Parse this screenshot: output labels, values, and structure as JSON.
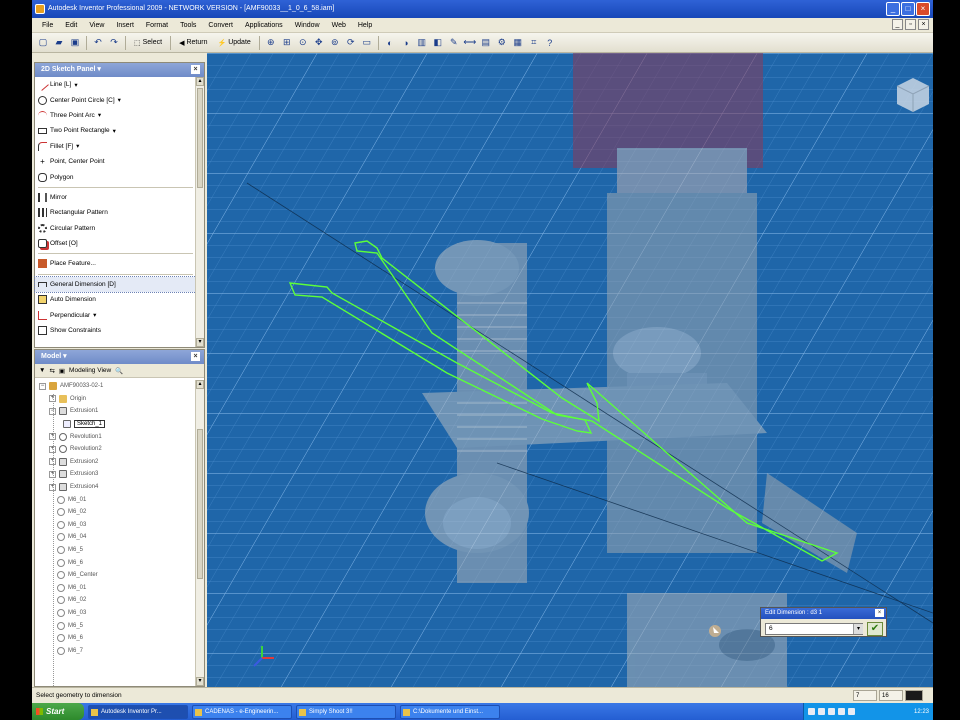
{
  "window": {
    "title": "Autodesk Inventor Professional 2009 - NETWORK VERSION - [AMF90033__1_0_6_58.iam]",
    "controls": [
      "_",
      "□",
      "×"
    ]
  },
  "menubar": {
    "items": [
      "File",
      "Edit",
      "View",
      "Insert",
      "Format",
      "Tools",
      "Convert",
      "Applications",
      "Window",
      "Web",
      "Help"
    ]
  },
  "toolbar": {
    "select_label": "Select",
    "return_label": "Return",
    "update_label": "Update"
  },
  "sketch_panel": {
    "title": "2D Sketch Panel",
    "items": [
      {
        "label": "Line  [L]",
        "icon": "line-icon"
      },
      {
        "label": "Center Point Circle  [C]",
        "icon": "circle-icon"
      },
      {
        "label": "Three Point Arc",
        "icon": "arc-icon"
      },
      {
        "label": "Two Point Rectangle",
        "icon": "rectangle-icon"
      },
      {
        "label": "Fillet  [F]",
        "icon": "fillet-icon"
      },
      {
        "label": "Point, Center Point",
        "icon": "point-icon"
      },
      {
        "label": "Polygon",
        "icon": "polygon-icon"
      },
      {
        "label": "Mirror",
        "icon": "mirror-icon"
      },
      {
        "label": "Rectangular Pattern",
        "icon": "rect-pattern-icon"
      },
      {
        "label": "Circular Pattern",
        "icon": "circ-pattern-icon"
      },
      {
        "label": "Offset  [O]",
        "icon": "offset-icon"
      },
      {
        "label": "Place Feature...",
        "icon": "place-feature-icon"
      },
      {
        "label": "General Dimension  [D]",
        "icon": "dimension-icon"
      },
      {
        "label": "Auto Dimension",
        "icon": "auto-dimension-icon"
      },
      {
        "label": "Perpendicular",
        "icon": "perpendicular-icon"
      },
      {
        "label": "Show Constraints",
        "icon": "constraints-icon"
      }
    ]
  },
  "model_panel": {
    "title": "Model",
    "view_label": "Modeling View",
    "tree": [
      {
        "label": "AMF90033-02-1",
        "level": 0
      },
      {
        "label": "Origin",
        "level": 1
      },
      {
        "label": "Extrusion1",
        "level": 1
      },
      {
        "label": "Sketch_1",
        "level": 2,
        "selected": true
      },
      {
        "label": "Revolution1",
        "level": 1
      },
      {
        "label": "Revolution2",
        "level": 1
      },
      {
        "label": "Extrusion2",
        "level": 1
      },
      {
        "label": "Extrusion3",
        "level": 1
      },
      {
        "label": "Extrusion4",
        "level": 1
      },
      {
        "label": "M6_01",
        "level": 1
      },
      {
        "label": "M6_02",
        "level": 1
      },
      {
        "label": "M6_03",
        "level": 1
      },
      {
        "label": "M6_04",
        "level": 1
      },
      {
        "label": "M6_5",
        "level": 1
      },
      {
        "label": "M6_6",
        "level": 1
      },
      {
        "label": "M6_Center",
        "level": 1
      },
      {
        "label": "M6_01",
        "level": 1
      },
      {
        "label": "M6_02",
        "level": 1
      },
      {
        "label": "M6_03",
        "level": 1
      },
      {
        "label": "M6_5",
        "level": 1
      },
      {
        "label": "M6_6",
        "level": 1
      },
      {
        "label": "M6_7",
        "level": 1
      }
    ]
  },
  "edit_dimension": {
    "title": "Edit Dimension : d3 1",
    "value": "6"
  },
  "status": {
    "text": "Select geometry to dimension",
    "field1": "7",
    "field2": "16"
  },
  "taskbar": {
    "start_label": "Start",
    "tasks": [
      {
        "label": "Autodesk Inventor Pr...",
        "active": true
      },
      {
        "label": "CADENAS - e-Engineerin...",
        "active": false
      },
      {
        "label": "Simply Shoot 3!!",
        "active": false
      },
      {
        "label": "C:\\Dokumente und Einst...",
        "active": false
      }
    ],
    "clock": "12:23"
  },
  "colors": {
    "viewport_bg": "#1f66a9",
    "grid_line": "#4d8fcf",
    "sketch_line": "#5cff3a",
    "title_blue": "#1747b8"
  }
}
